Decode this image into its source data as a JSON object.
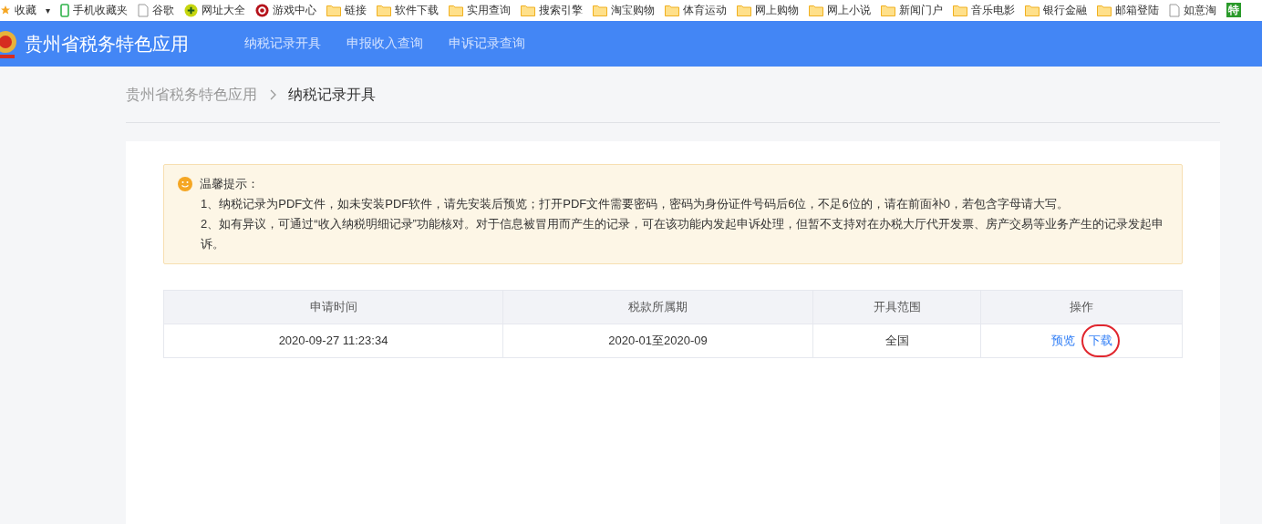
{
  "bookmarks": [
    {
      "kind": "star",
      "label": "收藏",
      "menu": "▾"
    },
    {
      "kind": "phone",
      "label": "手机收藏夹"
    },
    {
      "kind": "page",
      "label": "谷歌"
    },
    {
      "kind": "plus",
      "label": "网址大全"
    },
    {
      "kind": "game",
      "label": "游戏中心"
    },
    {
      "kind": "folder",
      "label": "链接"
    },
    {
      "kind": "folder",
      "label": "软件下载"
    },
    {
      "kind": "folder",
      "label": "实用查询"
    },
    {
      "kind": "folder",
      "label": "搜索引擎"
    },
    {
      "kind": "folder",
      "label": "淘宝购物"
    },
    {
      "kind": "folder",
      "label": "体育运动"
    },
    {
      "kind": "folder",
      "label": "网上购物"
    },
    {
      "kind": "folder",
      "label": "网上小说"
    },
    {
      "kind": "folder",
      "label": "新闻门户"
    },
    {
      "kind": "folder",
      "label": "音乐电影"
    },
    {
      "kind": "folder",
      "label": "银行金融"
    },
    {
      "kind": "folder",
      "label": "邮箱登陆"
    },
    {
      "kind": "page",
      "label": "如意淘"
    },
    {
      "kind": "badge",
      "label": "特"
    }
  ],
  "header": {
    "title": "贵州省税务特色应用",
    "nav": [
      {
        "label": "纳税记录开具",
        "selected": false
      },
      {
        "label": "申报收入查询",
        "selected": false
      },
      {
        "label": "申诉记录查询",
        "selected": false
      }
    ]
  },
  "breadcrumb": [
    {
      "label": "贵州省税务特色应用",
      "current": false
    },
    {
      "label": "纳税记录开具",
      "current": true
    }
  ],
  "notice": {
    "title": "温馨提示：",
    "lines": [
      "1、纳税记录为PDF文件，如未安装PDF软件，请先安装后预览；打开PDF文件需要密码，密码为身份证件号码后6位，不足6位的，请在前面补0，若包含字母请大写。",
      "2、如有异议，可通过“收入纳税明细记录”功能核对。对于信息被冒用而产生的记录，可在该功能内发起申诉处理，但暂不支持对在办税大厅代开发票、房产交易等业务产生的记录发起申诉。"
    ]
  },
  "table": {
    "columns": [
      "申请时间",
      "税款所属期",
      "开具范围",
      "操作"
    ],
    "rows": [
      {
        "cells": [
          "2020-09-27 11:23:34",
          "2020-01至2020-09",
          "全国"
        ],
        "actions": [
          {
            "label": "预览",
            "highlighted": false
          },
          {
            "label": "下载",
            "highlighted": true
          }
        ]
      }
    ]
  }
}
